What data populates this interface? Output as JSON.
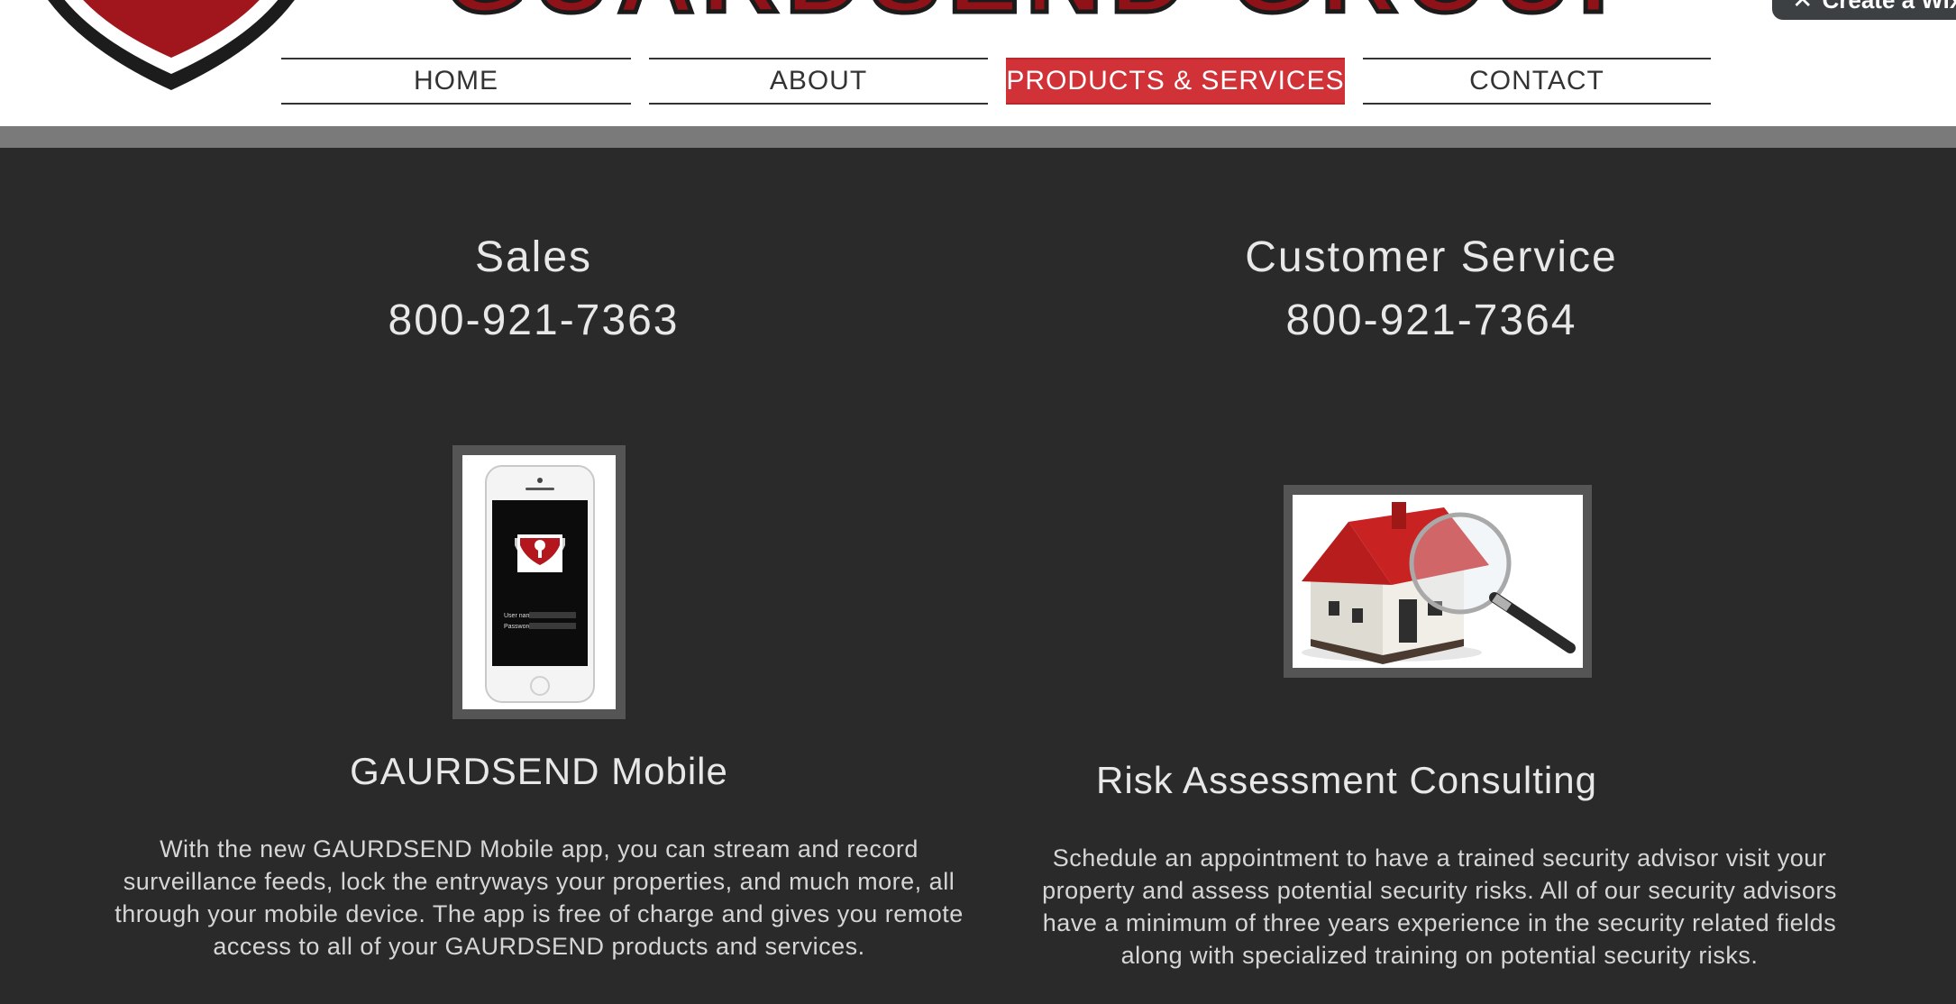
{
  "brand": {
    "name": "GUARDSEND GROUP"
  },
  "wix_banner": {
    "label": "Create a Wix"
  },
  "nav": {
    "items": [
      {
        "label": "HOME",
        "active": false
      },
      {
        "label": "ABOUT",
        "active": false
      },
      {
        "label": "PRODUCTS & SERVICES",
        "active": true
      },
      {
        "label": "CONTACT",
        "active": false
      }
    ],
    "active_color": "#d13238"
  },
  "contacts": {
    "sales": {
      "title": "Sales",
      "phone": "800-921-7363"
    },
    "customer_service": {
      "title": "Customer Service",
      "phone": "800-921-7364"
    }
  },
  "products": [
    {
      "title": "GAURDSEND Mobile",
      "description": "With the new GAURDSEND Mobile app, you can stream and record surveillance feeds, lock the entryways your properties, and much more, all through your mobile device. The app is free of charge and gives you remote access to all of your GAURDSEND products and services.",
      "image_icon": "phone-app-image",
      "screen": {
        "user_label": "User name",
        "pass_label": "Password"
      }
    },
    {
      "title": "Risk Assessment Consulting",
      "description": "Schedule an appointment to have a trained security advisor visit your property and assess potential security risks. All of our security advisors have a minimum of three years experience in the security related fields along with specialized training on potential security risks.",
      "image_icon": "house-magnifier-image"
    }
  ],
  "colors": {
    "background": "#2a2a2a",
    "header": "#ffffff",
    "band": "#7a7a7a",
    "brand_red": "#8e1217"
  }
}
